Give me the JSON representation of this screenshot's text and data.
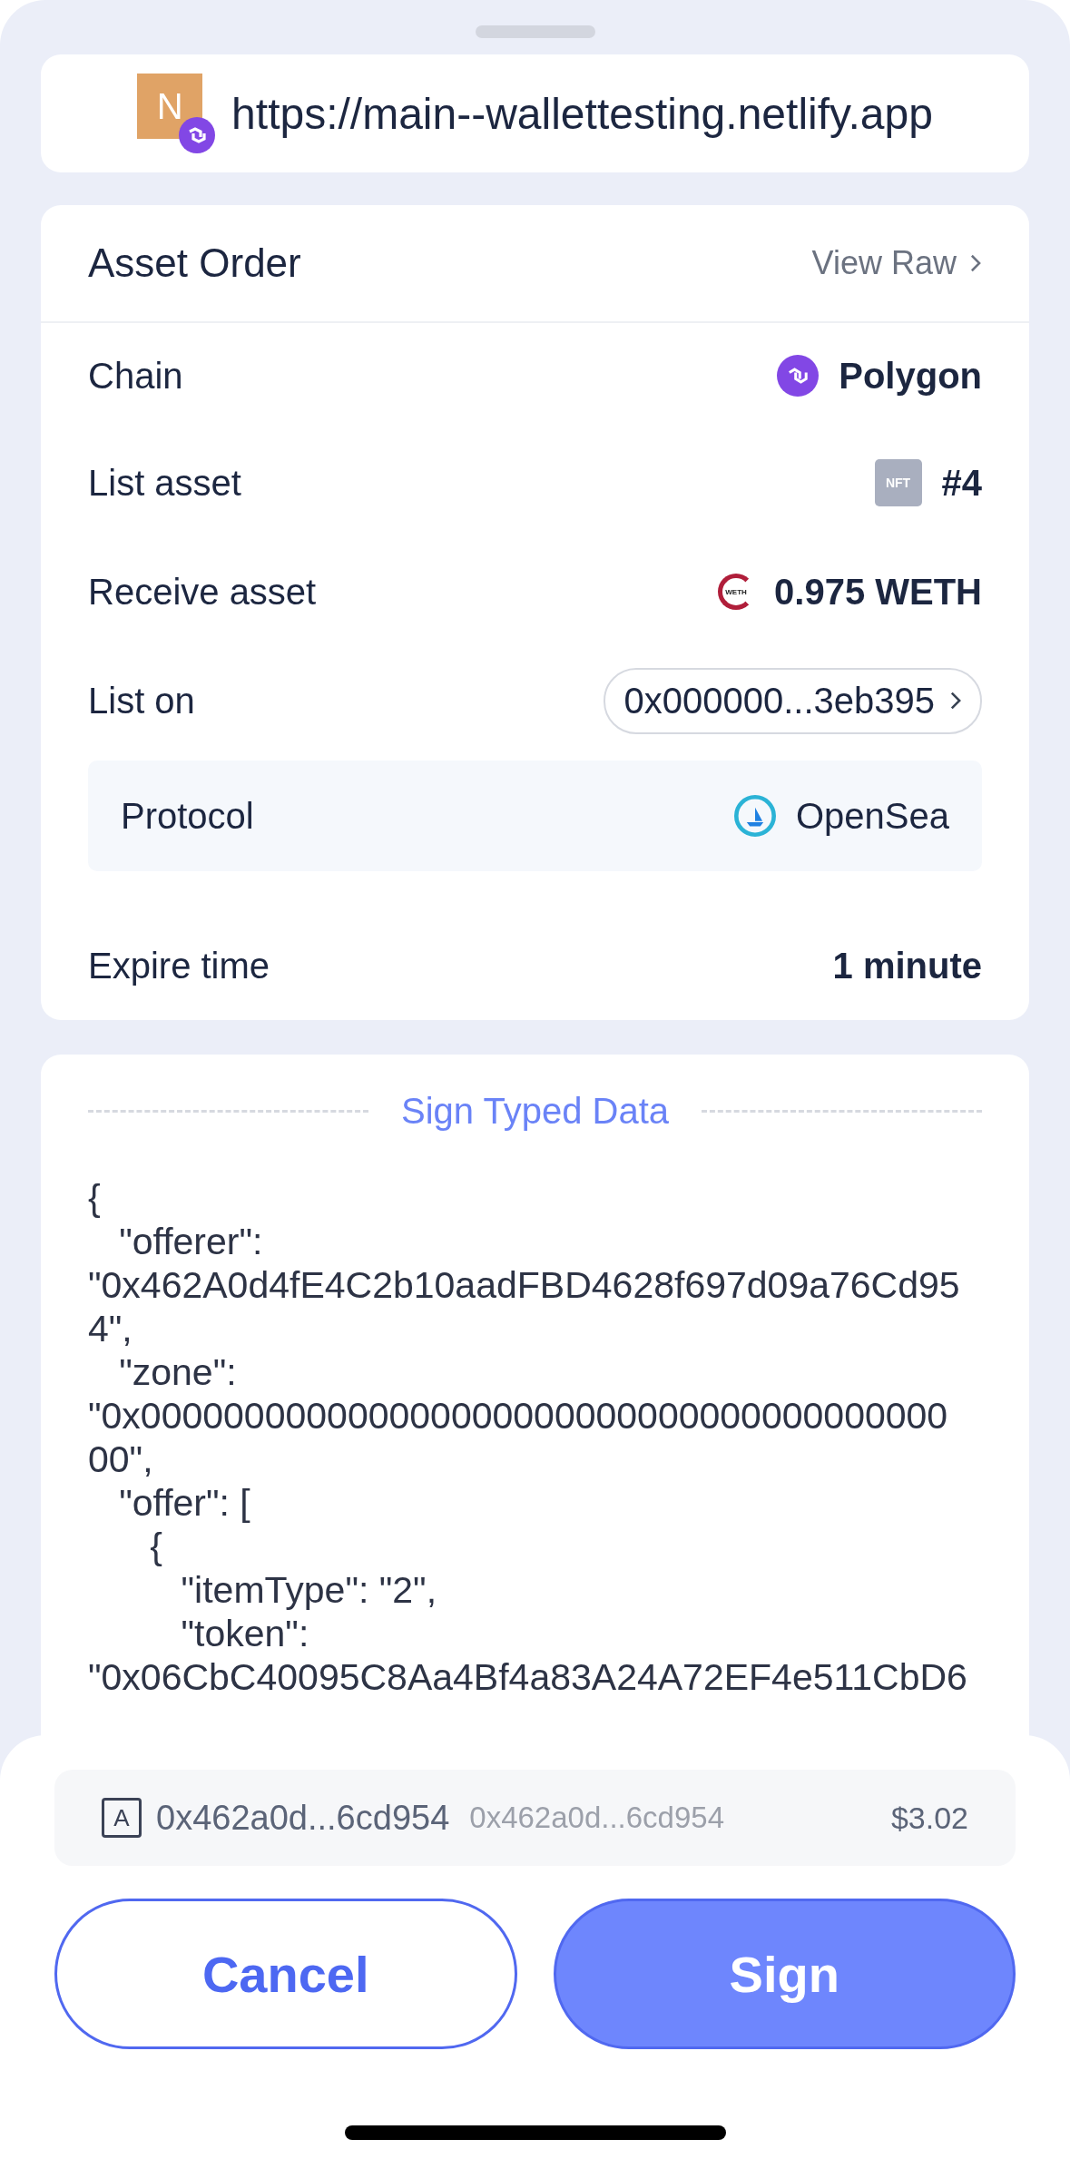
{
  "site": {
    "url": "https://main--wallettesting.netlify.app",
    "favicon_letter": "N"
  },
  "order": {
    "title": "Asset Order",
    "view_raw": "View Raw",
    "rows": [
      {
        "kind": "chain",
        "label": "Chain",
        "value": "Polygon"
      },
      {
        "kind": "nft",
        "label": "List asset",
        "badge": "NFT",
        "value": "#4"
      },
      {
        "kind": "token",
        "label": "Receive asset",
        "badge": "WETH",
        "value": "0.975 WETH"
      },
      {
        "kind": "address",
        "label": "List on",
        "value": "0x000000...3eb395"
      },
      {
        "kind": "protocol",
        "label": "Protocol",
        "value": "OpenSea"
      },
      {
        "kind": "plain",
        "label": "Expire time",
        "value": "1 minute"
      }
    ]
  },
  "typed_data": {
    "title": "Sign Typed Data",
    "lines": [
      "{",
      "   \"offerer\":",
      "\"0x462A0d4fE4C2b10aadFBD4628f697d09a76Cd95",
      "4\",",
      "   \"zone\":",
      "\"0x000000000000000000000000000000000000000",
      "00\",",
      "   \"offer\": [",
      "      {",
      "         \"itemType\": \"2\",",
      "         \"token\":",
      "\"0x06CbC40095C8Aa4Bf4a83A24A72EF4e511CbD6"
    ]
  },
  "account": {
    "badge": "A",
    "address": "0x462a0d...6cd954",
    "alias": "0x462a0d...6cd954",
    "balance": "$3.02"
  },
  "buttons": {
    "cancel": "Cancel",
    "sign": "Sign"
  }
}
